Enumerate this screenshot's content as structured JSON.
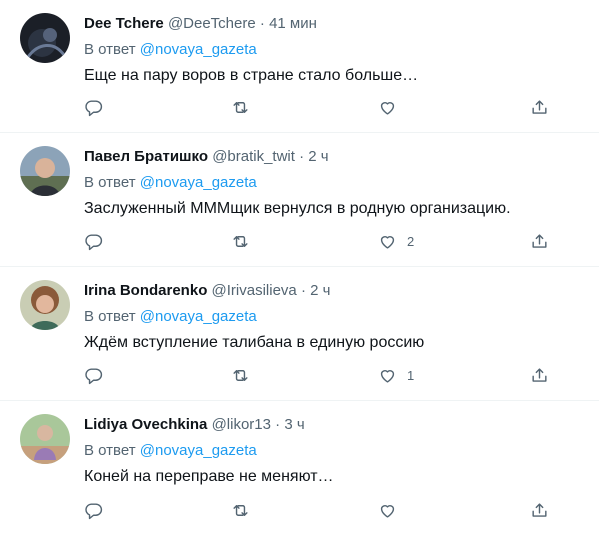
{
  "tweets": [
    {
      "name": "Dee Tchere",
      "handle": "@DeeTchere",
      "dot": "·",
      "time": "41 мин",
      "reply_prefix": "В ответ",
      "reply_to": "@novaya_gazeta",
      "text": "Еще на пару воров в стране стало больше…",
      "likes": ""
    },
    {
      "name": "Павел Братишко",
      "handle": "@bratik_twit",
      "dot": "·",
      "time": "2 ч",
      "reply_prefix": "В ответ",
      "reply_to": "@novaya_gazeta",
      "text": "Заслуженный МММщик вернулся в родную организацию.",
      "likes": "2"
    },
    {
      "name": "Irina Bondarenko",
      "handle": "@Irivasilieva",
      "dot": "·",
      "time": "2 ч",
      "reply_prefix": "В ответ",
      "reply_to": "@novaya_gazeta",
      "text": "Ждём вступление талибана в единую россию",
      "likes": "1"
    },
    {
      "name": "Lidiya Ovechkina",
      "handle": "@likor13",
      "dot": "·",
      "time": "3 ч",
      "reply_prefix": "В ответ",
      "reply_to": "@novaya_gazeta",
      "text": "Коней на переправе не меняют…",
      "likes": ""
    }
  ],
  "colors": {
    "accent": "#1d9bf0",
    "secondary_text": "#536471",
    "divider": "#eff3f4"
  },
  "icons": [
    "reply-icon",
    "retweet-icon",
    "like-icon",
    "share-icon"
  ]
}
